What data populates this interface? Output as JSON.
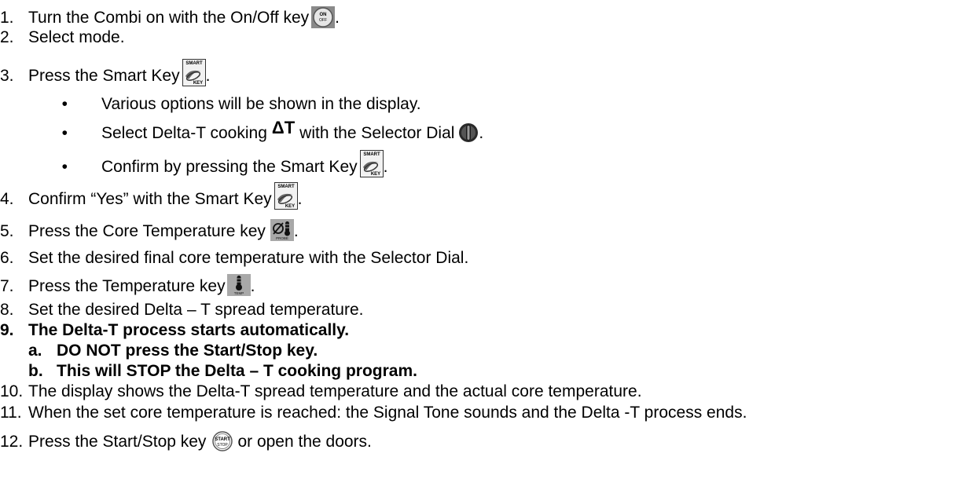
{
  "steps": [
    {
      "num": "1.",
      "text": "Turn the Combi on with the On/Off key",
      "after": ".",
      "icon": "on-off-key-icon",
      "icon_text": [
        "ON",
        "OFF"
      ]
    },
    {
      "num": "2.",
      "text": "Select mode."
    },
    {
      "num": "3.",
      "text": "Press the Smart Key",
      "after": ".",
      "icon": "smart-key-icon",
      "icon_text": [
        "SMART",
        "KEY"
      ]
    },
    {
      "num": "4.",
      "text": "Confirm “Yes” with the Smart Key",
      "after": ".",
      "icon": "smart-key-icon",
      "icon_text": [
        "SMART",
        "KEY"
      ]
    },
    {
      "num": "5.",
      "text": "Press the Core Temperature key",
      "after": ".",
      "icon": "core-temperature-key-icon",
      "icon_text": [
        "PROBE"
      ]
    },
    {
      "num": "6.",
      "text": "Set the desired final core temperature with the Selector Dial."
    },
    {
      "num": "7.",
      "text": "Press the Temperature key",
      "after": ".",
      "icon": "temperature-key-icon",
      "icon_text": [
        "TEMP"
      ]
    },
    {
      "num": "8.",
      "text": "Set the desired Delta – T spread temperature."
    },
    {
      "num": "9.",
      "text": "The Delta-T process starts automatically."
    },
    {
      "num": "10.",
      "text": "The display shows the Delta-T spread temperature and the actual core temperature."
    },
    {
      "num": "11.",
      "text": "When the set core temperature is reached: the Signal Tone sounds and the Delta -T process ends."
    },
    {
      "num": "12.",
      "text": "Press the Start/Stop key",
      "after": "or open the doors.",
      "icon": "start-stop-key-icon",
      "icon_text": [
        "START",
        "STOP"
      ]
    }
  ],
  "step3_bullets": [
    {
      "text": "Various options will be shown in the display."
    },
    {
      "text_before": "Select Delta-T cooking",
      "symbol": "ΔT",
      "text_middle": "with the Selector Dial",
      "after": "."
    },
    {
      "text": "Confirm by pressing the Smart Key",
      "after": "."
    }
  ],
  "step9_sub": [
    {
      "letter": "a.",
      "text": "DO NOT press the Start/Stop key."
    },
    {
      "letter": "b.",
      "text": "This will STOP the Delta – T cooking program."
    }
  ],
  "bullet_char": "•"
}
